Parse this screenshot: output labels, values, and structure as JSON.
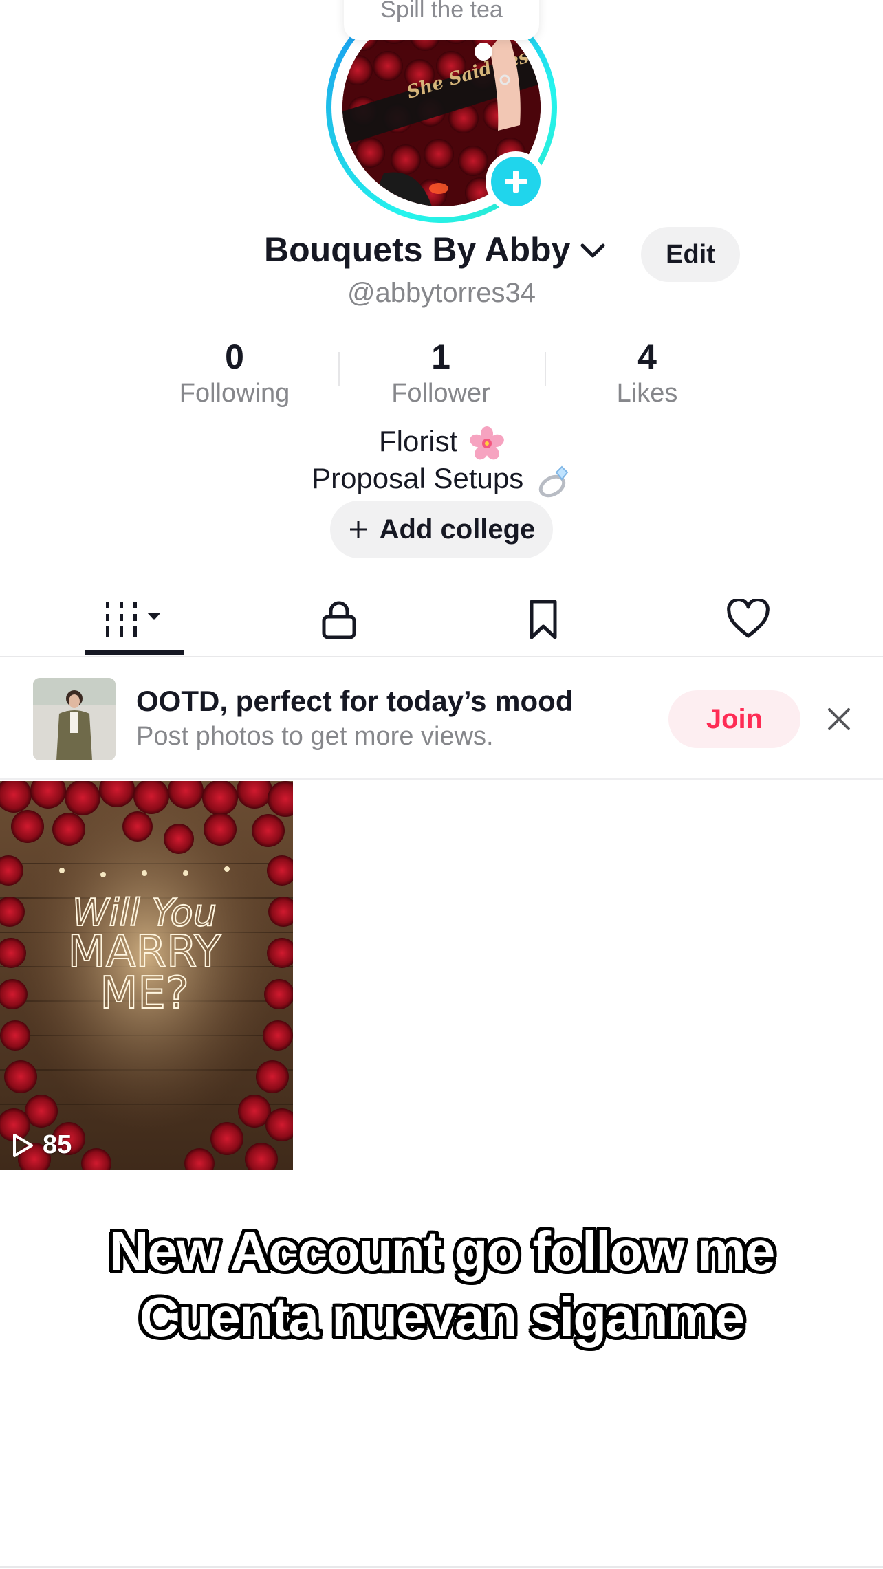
{
  "story_bubble": {
    "text": "Spill the tea"
  },
  "profile": {
    "display_name": "Bouquets By Abby",
    "handle": "@abbytorres34",
    "edit_label": "Edit",
    "avatar_text": "She Said Yes"
  },
  "stats": [
    {
      "value": "0",
      "label": "Following"
    },
    {
      "value": "1",
      "label": "Follower"
    },
    {
      "value": "4",
      "label": "Likes"
    }
  ],
  "bio": {
    "line1": "Florist",
    "line1_emoji": "cherry-blossom",
    "line2": "Proposal Setups",
    "line2_emoji": "ring"
  },
  "college_button": {
    "label": "Add college"
  },
  "tabs": [
    {
      "icon": "grid-icon",
      "active": true
    },
    {
      "icon": "lock-icon",
      "active": false
    },
    {
      "icon": "bookmark-icon",
      "active": false
    },
    {
      "icon": "heart-icon",
      "active": false
    }
  ],
  "promo": {
    "title": "OOTD, perfect for today’s mood",
    "subtitle": "Post photos to get more views.",
    "join_label": "Join"
  },
  "videos": [
    {
      "views": "85",
      "overlay_line1": "Will You",
      "overlay_line2": "MARRY",
      "overlay_line3": "ME?"
    }
  ],
  "caption": {
    "line1": "New Account go follow me",
    "line2": "Cuenta nuevan siganme"
  },
  "colors": {
    "accent_red": "#fe2c55",
    "story_ring": "#25f4ee",
    "add_story_blue": "#20d5ec",
    "text_primary": "#161823",
    "text_secondary": "#86878b"
  }
}
